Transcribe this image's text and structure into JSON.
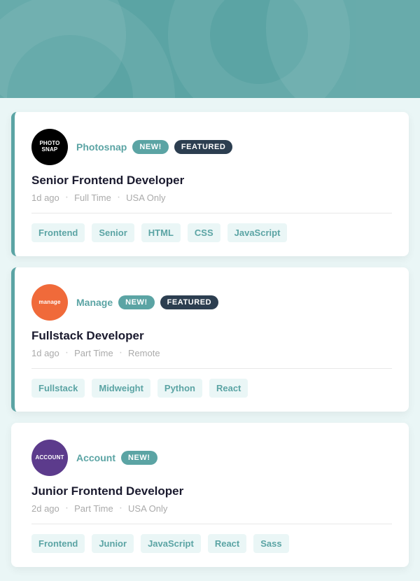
{
  "hero": {
    "bg_color": "#5ba4a4"
  },
  "jobs": [
    {
      "id": "job-1",
      "company": "Photosnap",
      "logo_class": "logo-photosnap",
      "logo_text": "PHOTOSNAP",
      "is_new": true,
      "is_featured": true,
      "new_label": "NEW!",
      "featured_label": "FEATURED",
      "title": "Senior Frontend Developer",
      "posted": "1d ago",
      "type": "Full Time",
      "location": "USA Only",
      "tags": [
        "Frontend",
        "Senior",
        "HTML",
        "CSS",
        "JavaScript"
      ]
    },
    {
      "id": "job-2",
      "company": "Manage",
      "logo_class": "logo-manage",
      "logo_text": "manage",
      "is_new": true,
      "is_featured": true,
      "new_label": "NEW!",
      "featured_label": "FEATURED",
      "title": "Fullstack Developer",
      "posted": "1d ago",
      "type": "Part Time",
      "location": "Remote",
      "tags": [
        "Fullstack",
        "Midweight",
        "Python",
        "React"
      ]
    },
    {
      "id": "job-3",
      "company": "Account",
      "logo_class": "logo-account",
      "logo_text": "ACCOUNT",
      "is_new": true,
      "is_featured": false,
      "new_label": "NEW!",
      "featured_label": "",
      "title": "Junior Frontend Developer",
      "posted": "2d ago",
      "type": "Part Time",
      "location": "USA Only",
      "tags": [
        "Frontend",
        "Junior",
        "JavaScript",
        "React",
        "Sass"
      ]
    }
  ]
}
